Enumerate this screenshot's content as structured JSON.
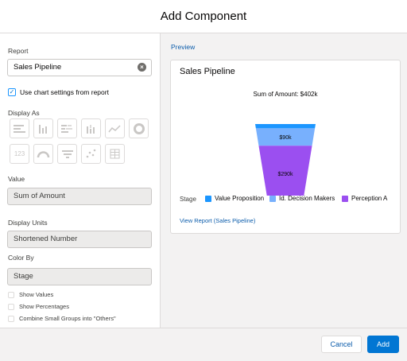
{
  "modal": {
    "title": "Add Component"
  },
  "form": {
    "report_label": "Report",
    "report_value": "Sales Pipeline",
    "use_chart_settings_label": "Use chart settings from report",
    "use_chart_settings_checked": true,
    "display_as_label": "Display As",
    "display_as_options": [
      "horizontal-bar",
      "vertical-bar",
      "stacked-horizontal-bar",
      "stacked-vertical-bar",
      "line",
      "donut",
      "metric",
      "gauge",
      "funnel",
      "scatter",
      "table"
    ],
    "display_as_metric_text": "123",
    "value_label": "Value",
    "value_value": "Sum of Amount",
    "display_units_label": "Display Units",
    "display_units_value": "Shortened Number",
    "color_by_label": "Color By",
    "color_by_value": "Stage",
    "show_values_label": "Show Values",
    "show_percentages_label": "Show Percentages",
    "combine_small_groups_label": "Combine Small Groups into \"Others\""
  },
  "preview": {
    "label": "Preview",
    "card_title": "Sales Pipeline",
    "legend_title": "Stage",
    "view_report_link": "View Report (Sales Pipeline)"
  },
  "chart_data": {
    "type": "funnel",
    "title": "Sum of Amount: $402k",
    "legend_title": "Stage",
    "categories": [
      "Value Proposition",
      "Id. Decision Makers",
      "Perception A"
    ],
    "values": [
      22,
      90,
      290
    ],
    "value_labels": [
      "",
      "$90k",
      "$290k"
    ],
    "colors": [
      "#1b96ff",
      "#78b0fd",
      "#9b4ff0"
    ],
    "legend_placement": "bottom"
  },
  "footer": {
    "cancel_label": "Cancel",
    "add_label": "Add"
  }
}
